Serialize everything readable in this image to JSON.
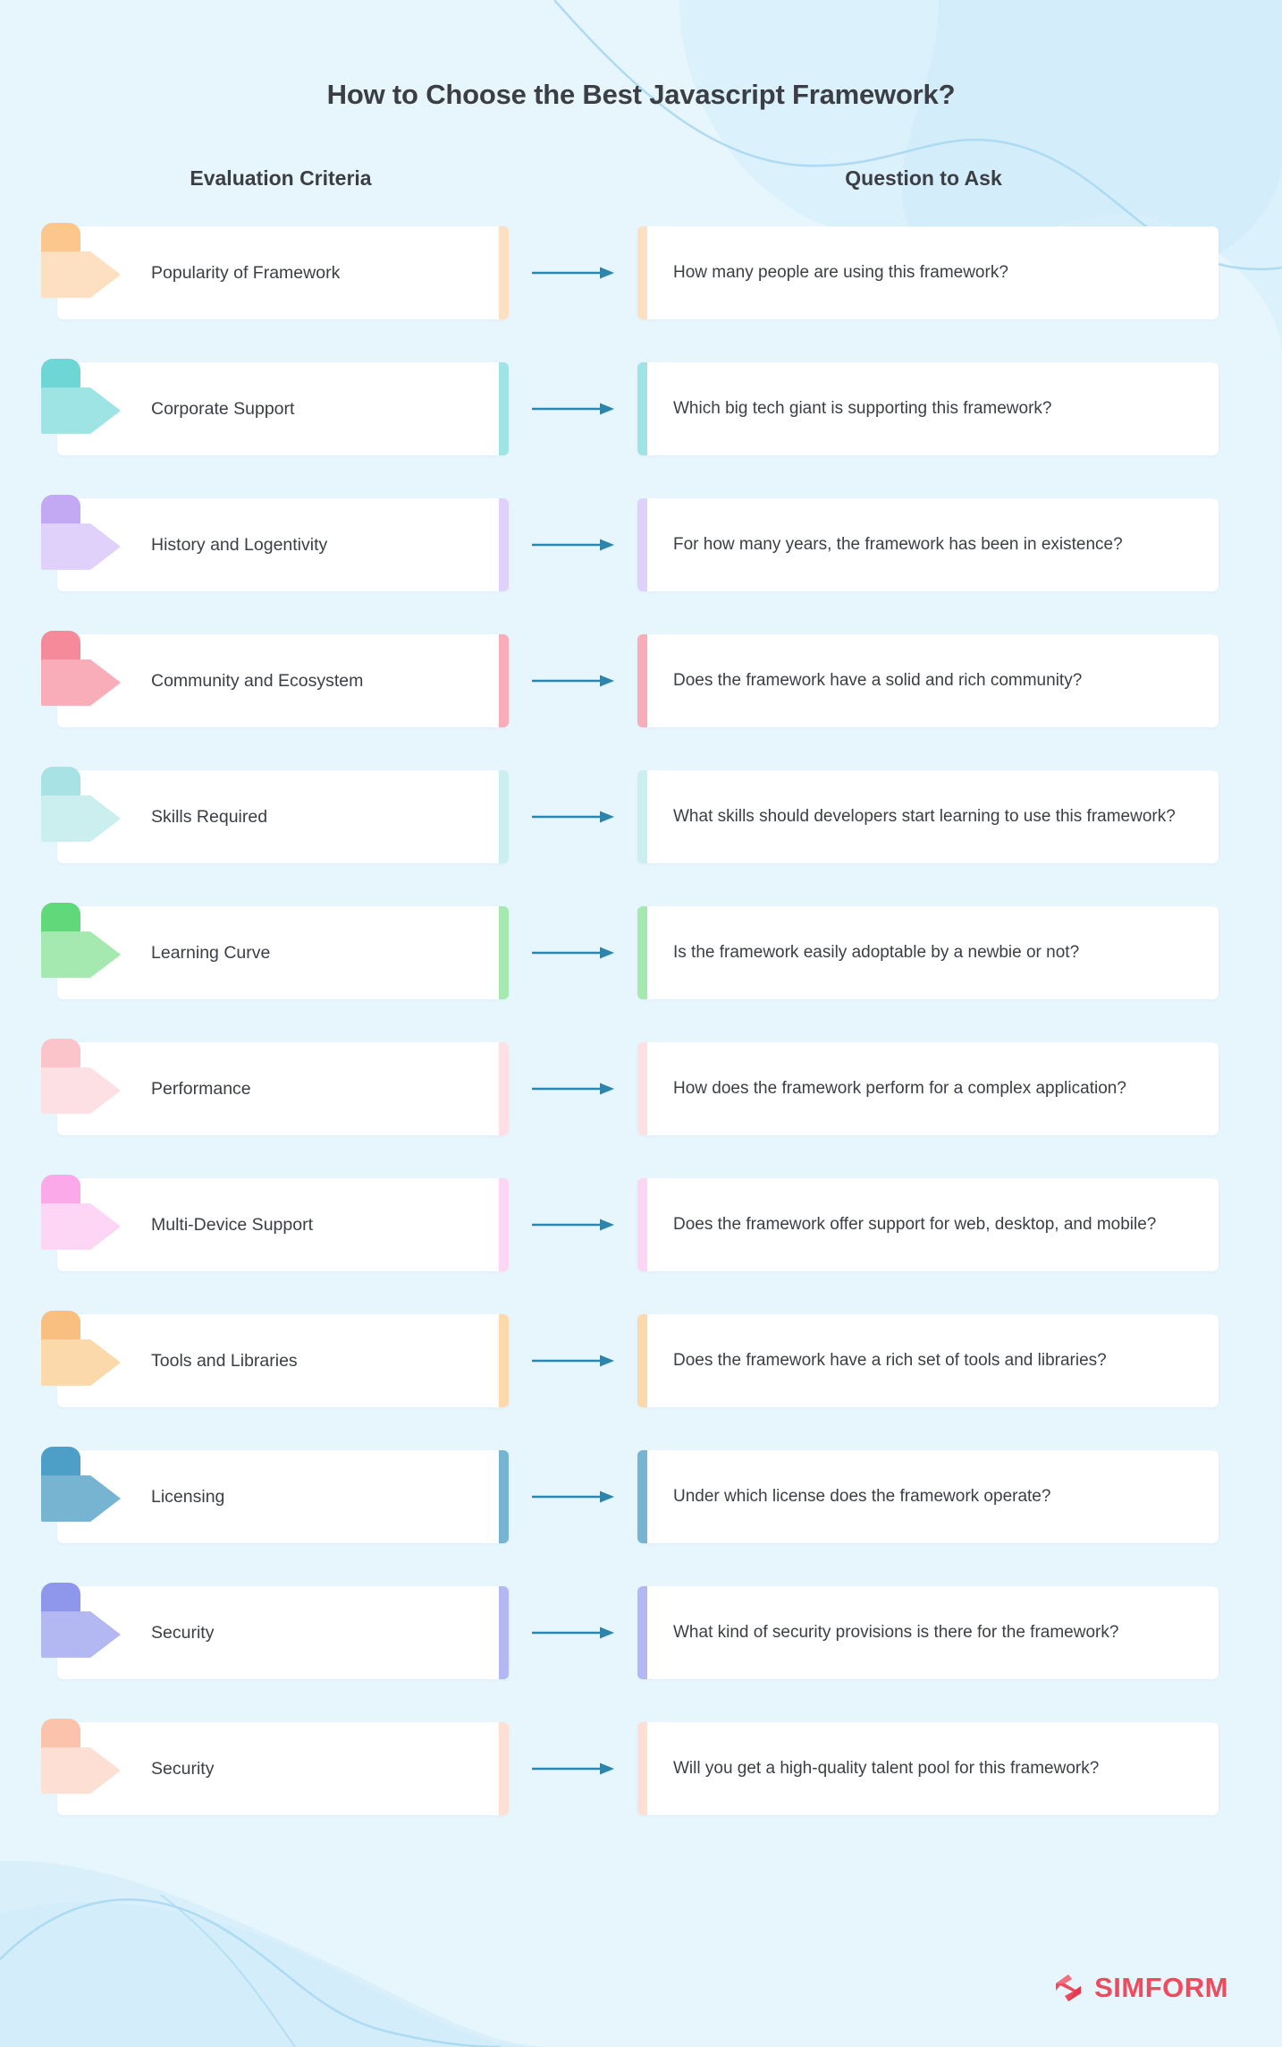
{
  "page": {
    "title": "How to Choose the Best Javascript Framework?",
    "background_color": "#e7f6fd",
    "arrow_color": "#2b85ad",
    "text_color": "#3b3f45"
  },
  "headers": {
    "left": "Evaluation Criteria",
    "right": "Question to Ask"
  },
  "rows": [
    {
      "criteria": "Popularity of Framework",
      "question": "How many people are using this framework?",
      "color": "#fde0c1",
      "color_dark": "#fcc78c"
    },
    {
      "criteria": "Corporate Support",
      "question": "Which big tech giant is supporting this framework?",
      "color": "#9fe4e4",
      "color_dark": "#6fd6d6"
    },
    {
      "criteria": "History and Logentivity",
      "question": "For how many years, the framework has been in existence?",
      "color": "#e0d1fa",
      "color_dark": "#c3a9f3"
    },
    {
      "criteria": "Community and Ecosystem",
      "question": "Does the framework have a solid and rich community?",
      "color": "#f9adb8",
      "color_dark": "#f58a9a"
    },
    {
      "criteria": "Skills Required",
      "question": "What skills should developers start learning to use this framework?",
      "color": "#cbeeee",
      "color_dark": "#a8e2e4"
    },
    {
      "criteria": "Learning Curve",
      "question": "Is the framework easily adoptable by a newbie or not?",
      "color": "#a5e8b0",
      "color_dark": "#61d87a"
    },
    {
      "criteria": "Performance",
      "question": "How does the framework perform for a complex application?",
      "color": "#fde0e3",
      "color_dark": "#fbc4ca"
    },
    {
      "criteria": "Multi-Device Support",
      "question": "Does the framework offer support for web, desktop, and mobile?",
      "color": "#fcd6f4",
      "color_dark": "#fba9e9"
    },
    {
      "criteria": "Tools and Libraries",
      "question": "Does the framework have a rich set of tools and libraries?",
      "color": "#fcd9ab",
      "color_dark": "#f8bf80"
    },
    {
      "criteria": "Licensing",
      "question": "Under which license does the framework operate?",
      "color": "#77b4d2",
      "color_dark": "#4e9fc7"
    },
    {
      "criteria": "Security",
      "question": "What kind of security provisions is there for the framework?",
      "color": "#b3b8f2",
      "color_dark": "#8f97ec"
    },
    {
      "criteria": "Security",
      "question": "Will you get a high-quality talent pool for this framework?",
      "color": "#fde0d3",
      "color_dark": "#fbc3ac"
    }
  ],
  "logo": {
    "word": "SIMFORM",
    "mark": "simform-diamond-icon",
    "color": "#ef4a5e"
  }
}
